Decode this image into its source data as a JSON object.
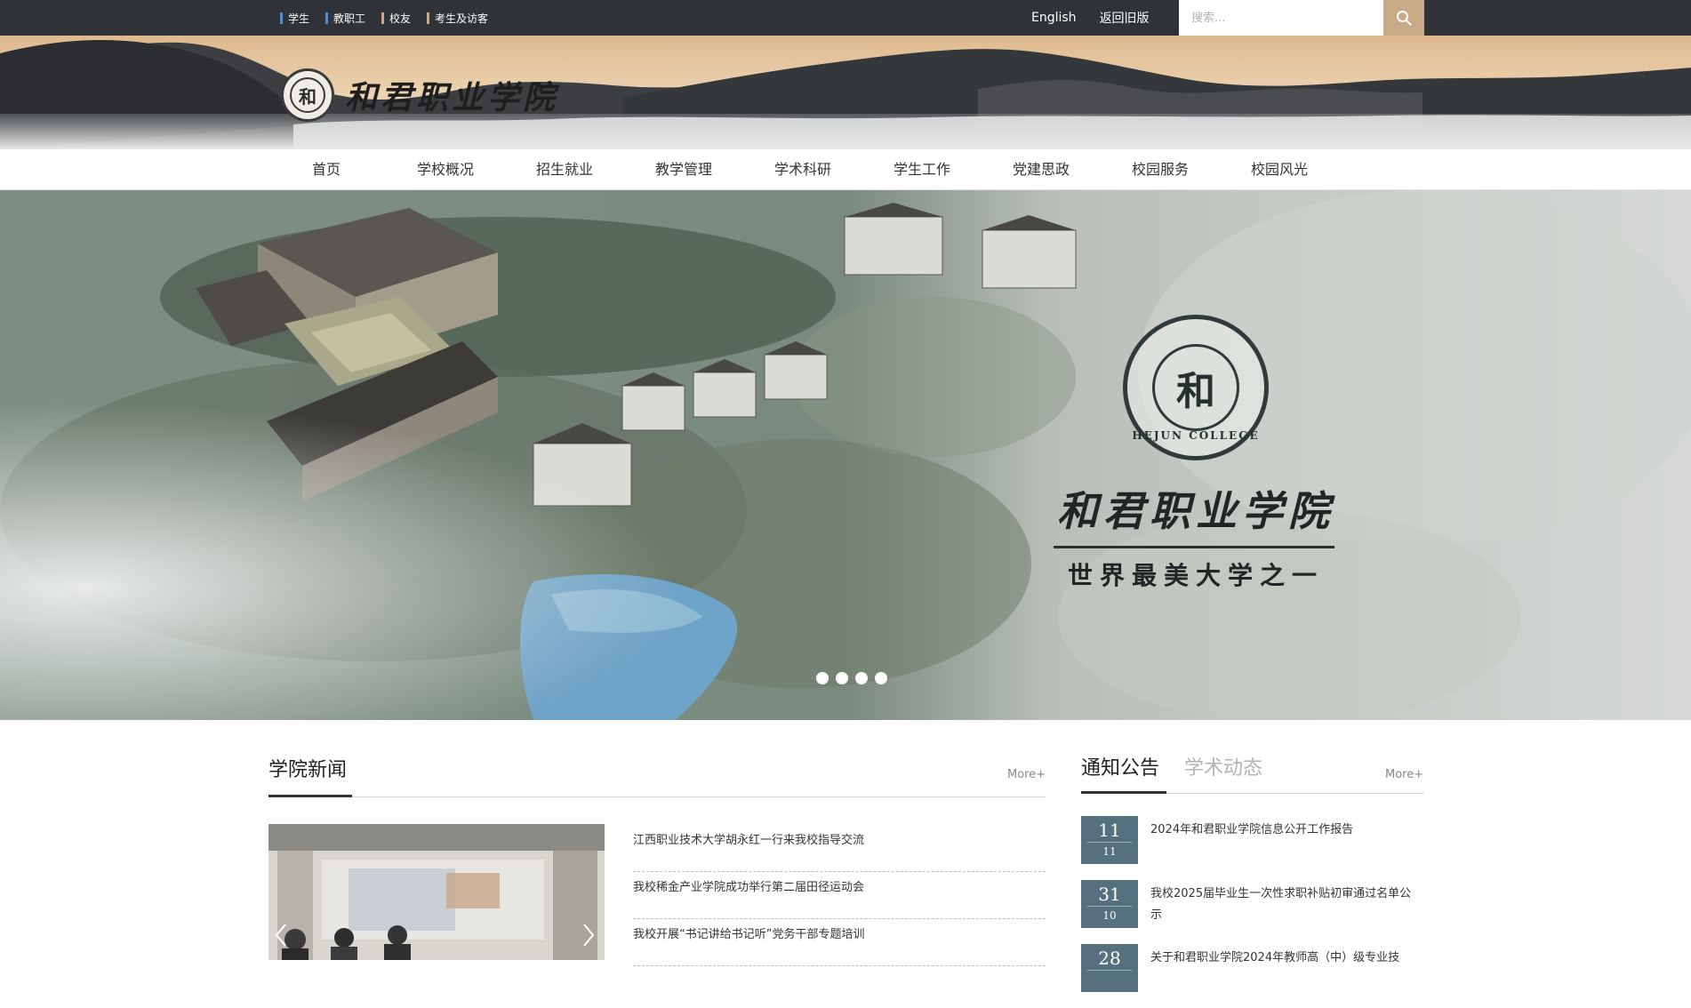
{
  "colors": {
    "topbar_bg": "#2f3237",
    "quicklink_accents": [
      "#4d8fd6",
      "#4d8fd6",
      "#c8aa86",
      "#c8aa86"
    ],
    "search_button": "#c8aa86",
    "date_box": "#57707f",
    "tab_inactive": "#b4b4b4"
  },
  "topbar": {
    "quick_links": [
      {
        "label": "学生",
        "icon": "accent-bar"
      },
      {
        "label": "教职工",
        "icon": "accent-bar"
      },
      {
        "label": "校友",
        "icon": "accent-bar"
      },
      {
        "label": "考生及访客",
        "icon": "accent-bar"
      }
    ],
    "english_label": "English",
    "old_version_label": "返回旧版",
    "search_placeholder": "搜索...",
    "search_icon": "search-icon"
  },
  "header": {
    "logo_seal_char": "和",
    "site_name": "和君职业学院"
  },
  "nav": {
    "items": [
      "首页",
      "学校概况",
      "招生就业",
      "教学管理",
      "学术科研",
      "学生工作",
      "党建思政",
      "校园服务",
      "校园风光"
    ]
  },
  "hero": {
    "seal_char": "和",
    "seal_text": "HEJUN COLLEGE",
    "school_name": "和君职业学院",
    "slogan": "世界最美大学之一",
    "slide_count": 4
  },
  "news": {
    "title": "学院新闻",
    "more_label": "More+",
    "items": [
      "江西职业技术大学胡永红一行来我校指导交流",
      "我校稀金产业学院成功举行第二届田径运动会",
      "我校开展“书记讲给书记听”党务干部专题培训"
    ]
  },
  "notices": {
    "tab_active": "通知公告",
    "tab_inactive": "学术动态",
    "more_label": "More+",
    "items": [
      {
        "day": "11",
        "month": "11",
        "text": "2024年和君职业学院信息公开工作报告"
      },
      {
        "day": "31",
        "month": "10",
        "text": "我校2025届毕业生一次性求职补贴初审通过名单公示"
      },
      {
        "day": "28",
        "month": "",
        "text": "关于和君职业学院2024年教师高（中）级专业技"
      }
    ]
  }
}
